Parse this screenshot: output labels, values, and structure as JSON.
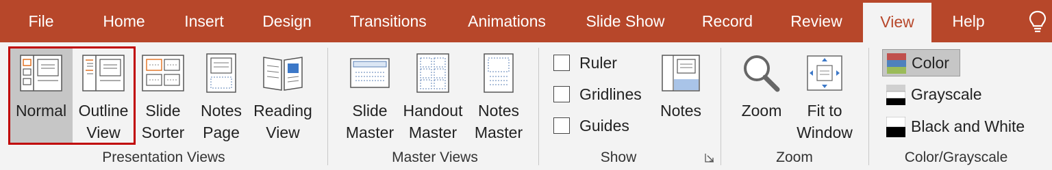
{
  "tabs": [
    {
      "label": "File"
    },
    {
      "label": "Home"
    },
    {
      "label": "Insert"
    },
    {
      "label": "Design"
    },
    {
      "label": "Transitions"
    },
    {
      "label": "Animations"
    },
    {
      "label": "Slide Show"
    },
    {
      "label": "Record"
    },
    {
      "label": "Review"
    },
    {
      "label": "View",
      "active": true
    },
    {
      "label": "Help"
    }
  ],
  "tell_me_icon": "lightbulb-icon",
  "groups": {
    "presentation_views": {
      "label": "Presentation Views",
      "buttons": [
        {
          "line1": "Normal",
          "line2": "",
          "icon": "normal-view-icon",
          "selected": true
        },
        {
          "line1": "Outline",
          "line2": "View",
          "icon": "outline-view-icon"
        },
        {
          "line1": "Slide",
          "line2": "Sorter",
          "icon": "slide-sorter-icon"
        },
        {
          "line1": "Notes",
          "line2": "Page",
          "icon": "notes-page-icon"
        },
        {
          "line1": "Reading",
          "line2": "View",
          "icon": "reading-view-icon"
        }
      ]
    },
    "master_views": {
      "label": "Master Views",
      "buttons": [
        {
          "line1": "Slide",
          "line2": "Master",
          "icon": "slide-master-icon"
        },
        {
          "line1": "Handout",
          "line2": "Master",
          "icon": "handout-master-icon"
        },
        {
          "line1": "Notes",
          "line2": "Master",
          "icon": "notes-master-icon"
        }
      ]
    },
    "show": {
      "label": "Show",
      "checkboxes": [
        {
          "label": "Ruler",
          "checked": false
        },
        {
          "label": "Gridlines",
          "checked": false
        },
        {
          "label": "Guides",
          "checked": false
        }
      ],
      "notes_button": {
        "line1": "Notes",
        "icon": "notes-icon"
      }
    },
    "zoom": {
      "label": "Zoom",
      "buttons": [
        {
          "line1": "Zoom",
          "line2": "",
          "icon": "zoom-icon"
        },
        {
          "line1": "Fit to",
          "line2": "Window",
          "icon": "fit-to-window-icon"
        }
      ]
    },
    "color_grayscale": {
      "label": "Color/Grayscale",
      "options": [
        {
          "label": "Color",
          "selected": true
        },
        {
          "label": "Grayscale"
        },
        {
          "label": "Black and White"
        }
      ]
    }
  },
  "colors": {
    "accent": "#b7472a",
    "ribbon_bg": "#f3f3f3",
    "selected_bg": "#c6c6c6",
    "focus_border": "#c00000"
  }
}
